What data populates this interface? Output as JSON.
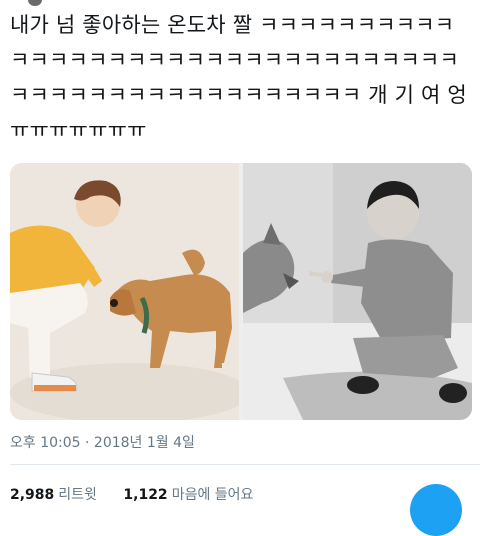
{
  "tweet": {
    "text": "내가 넘 좋아하는 온도차 짤 ㅋㅋㅋㅋㅋㅋㅋㅋㅋㅋㅋㅋㅋㅋㅋㅋㅋㅋㅋㅋㅋㅋㅋㅋㅋㅋㅋㅋㅋㅋㅋㅋㅋㅋㅋㅋㅋㅋㅋㅋㅋㅋㅋㅋㅋㅋㅋㅋㅋㅋㅋ 개 기 여 엉ㅠㅠㅠㅠㅠㅠㅠ",
    "timestamp": "오후 10:05 · 2018년 1월 4일",
    "retweets_count": "2,988",
    "retweets_label": "리트윗",
    "likes_count": "1,122",
    "likes_label": "마음에 들어요"
  },
  "colors": {
    "accent": "#1da1f2",
    "meta": "#657786"
  }
}
